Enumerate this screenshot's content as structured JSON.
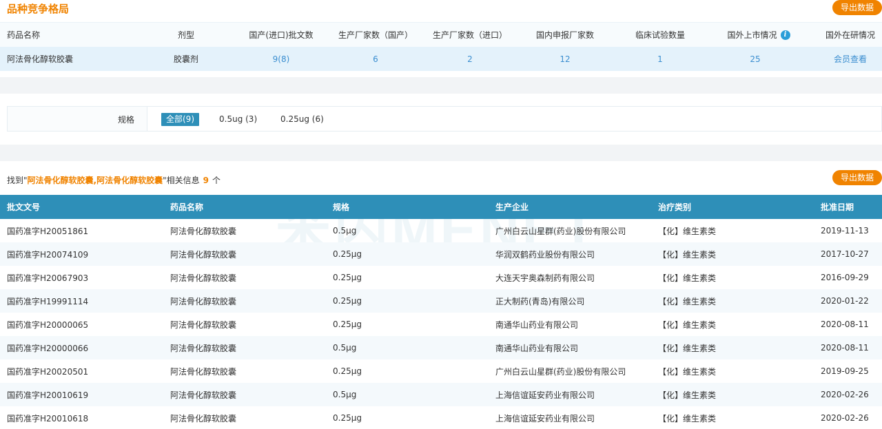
{
  "section": {
    "title": "品种竞争格局",
    "export_label": "导出数据"
  },
  "competition": {
    "headers": [
      "药品名称",
      "剂型",
      "国产(进口)批文数",
      "生产厂家数（国产）",
      "生产厂家数（进口）",
      "国内申报厂家数",
      "临床试验数量",
      "国外上市情况",
      "国外在研情况"
    ],
    "row": {
      "name": "阿法骨化醇软胶囊",
      "form": "胶囊剂",
      "approvals": "9(8)",
      "domestic_makers": "6",
      "import_makers": "2",
      "domestic_filers": "12",
      "trials": "1",
      "foreign_marketed": "25",
      "foreign_rd": "会员查看"
    },
    "info_icon": "info-icon"
  },
  "spec_filter": {
    "label": "规格",
    "options": [
      "全部(9)",
      "0.5ug (3)",
      "0.25ug (6)"
    ],
    "selected": "全部(9)"
  },
  "search_result": {
    "prefix": "找到\"",
    "keyword": "阿法骨化醇软胶囊,阿法骨化醇软胶囊",
    "suffix": "\"相关信息",
    "count": "9",
    "unit": "个",
    "export_label": "导出数据"
  },
  "watermark": "米内MENET",
  "table": {
    "headers": [
      "批文文号",
      "药品名称",
      "规格",
      "生产企业",
      "治疗类别",
      "批准日期"
    ],
    "rows": [
      [
        "国药准字H20051861",
        "阿法骨化醇软胶囊",
        "0.5μg",
        "广州白云山星群(药业)股份有限公司",
        "【化】维生素类",
        "2019-11-13"
      ],
      [
        "国药准字H20074109",
        "阿法骨化醇软胶囊",
        "0.25μg",
        "华润双鹤药业股份有限公司",
        "【化】维生素类",
        "2017-10-27"
      ],
      [
        "国药准字H20067903",
        "阿法骨化醇软胶囊",
        "0.25μg",
        "大连天宇奥森制药有限公司",
        "【化】维生素类",
        "2016-09-29"
      ],
      [
        "国药准字H19991114",
        "阿法骨化醇软胶囊",
        "0.25μg",
        "正大制药(青岛)有限公司",
        "【化】维生素类",
        "2020-01-22"
      ],
      [
        "国药准字H20000065",
        "阿法骨化醇软胶囊",
        "0.25μg",
        "南通华山药业有限公司",
        "【化】维生素类",
        "2020-08-11"
      ],
      [
        "国药准字H20000066",
        "阿法骨化醇软胶囊",
        "0.5μg",
        "南通华山药业有限公司",
        "【化】维生素类",
        "2020-08-11"
      ],
      [
        "国药准字H20020501",
        "阿法骨化醇软胶囊",
        "0.25μg",
        "广州白云山星群(药业)股份有限公司",
        "【化】维生素类",
        "2019-09-25"
      ],
      [
        "国药准字H20010619",
        "阿法骨化醇软胶囊",
        "0.5μg",
        "上海信谊延安药业有限公司",
        "【化】维生素类",
        "2020-02-26"
      ],
      [
        "国药准字H20010618",
        "阿法骨化醇软胶囊",
        "0.25μg",
        "上海信谊延安药业有限公司",
        "【化】维生素类",
        "2020-02-26"
      ]
    ]
  },
  "colors": {
    "accent": "#f08300",
    "header_blue": "#2e8fb8",
    "link": "#3b8ed0"
  }
}
